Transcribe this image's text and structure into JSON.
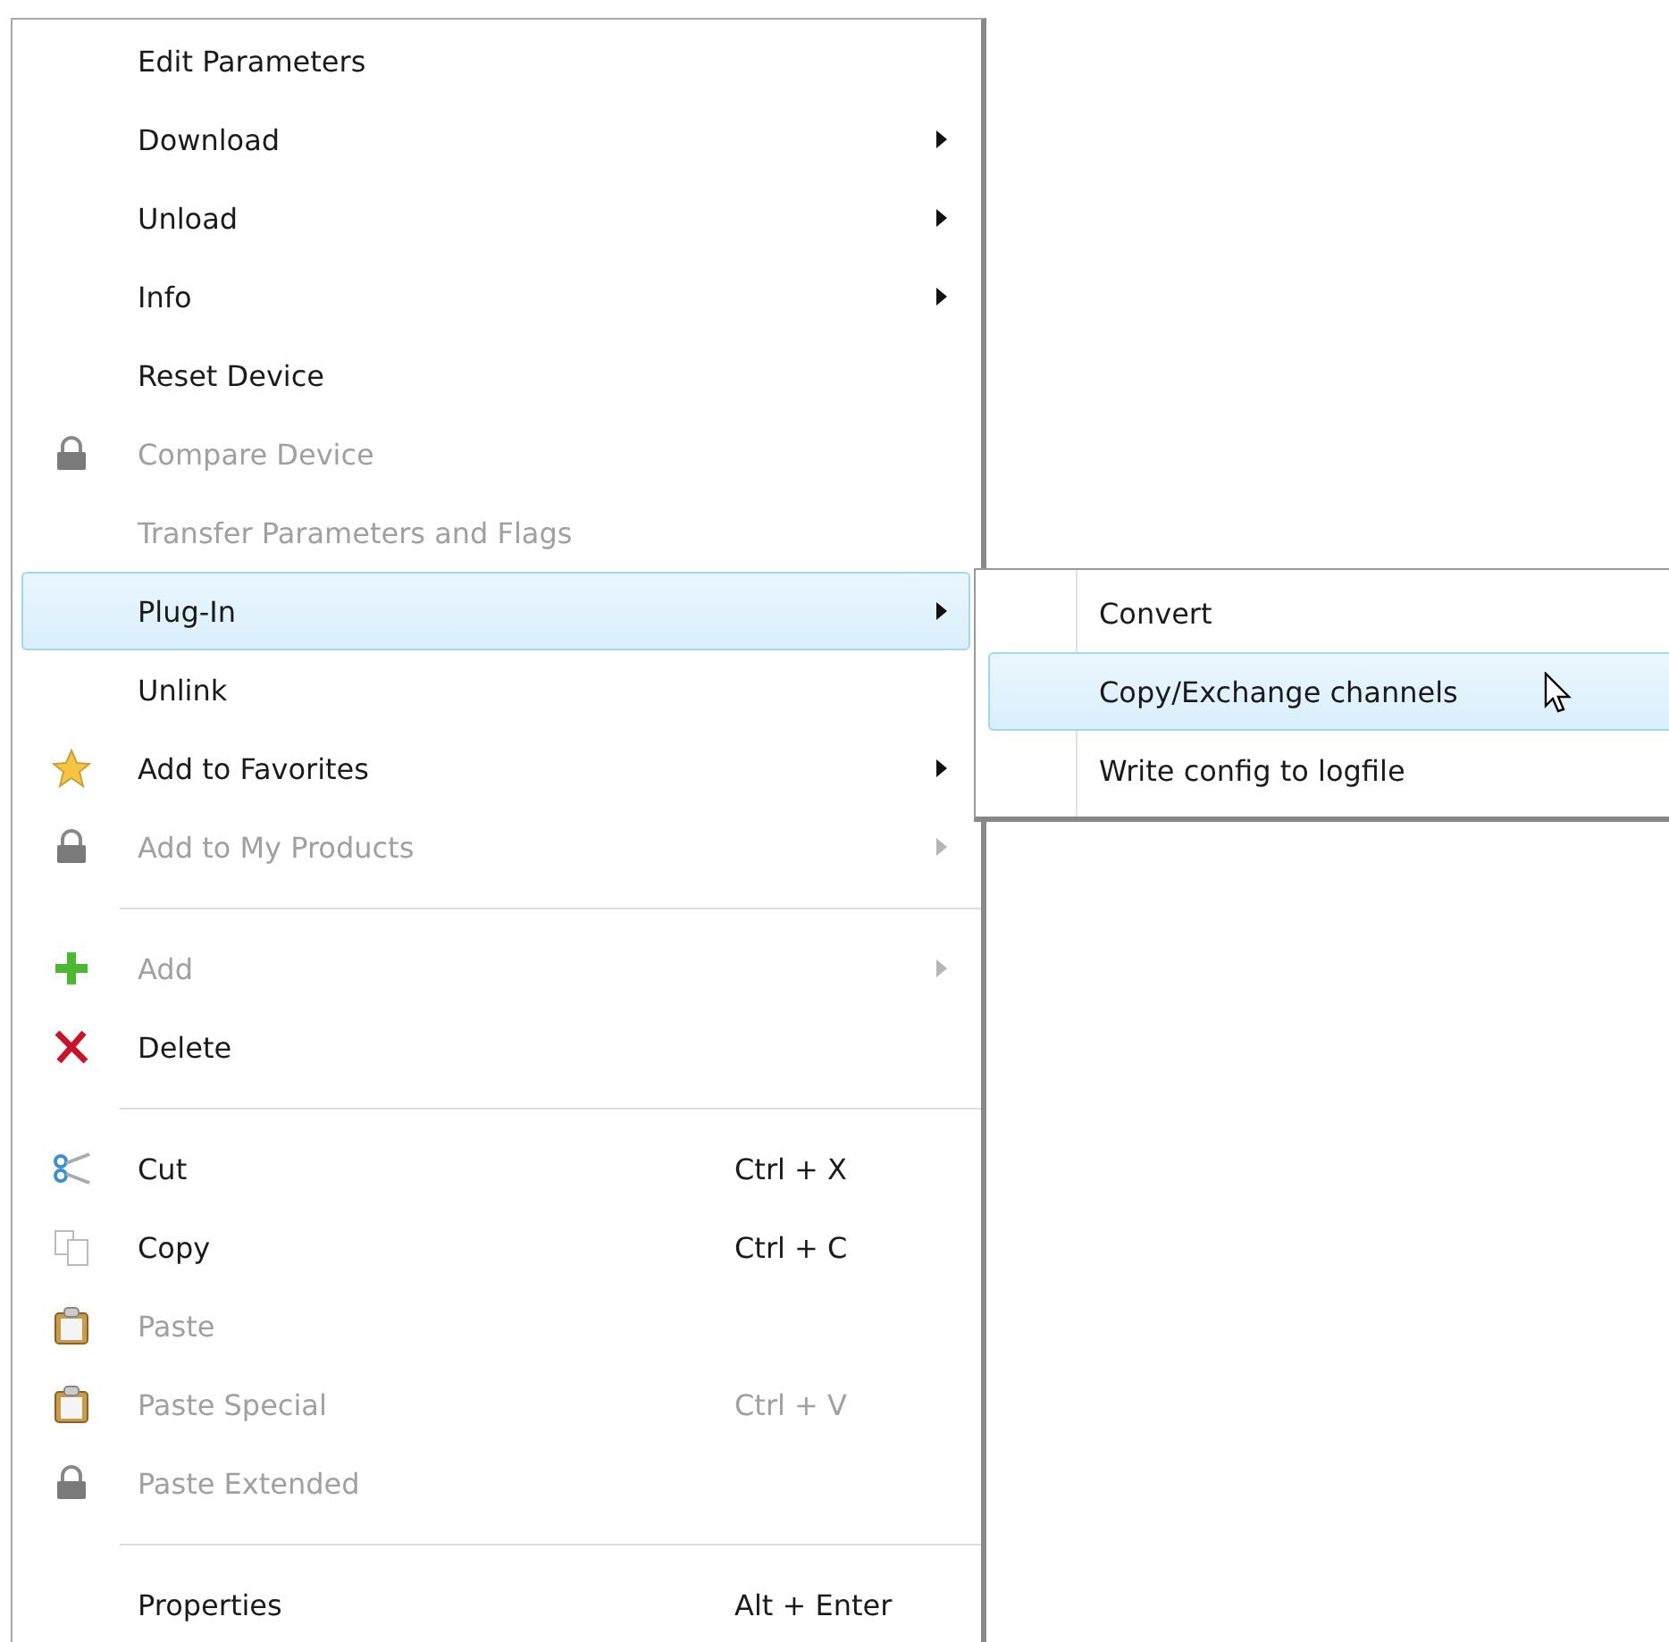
{
  "menu": {
    "items": [
      {
        "kind": "plain",
        "label": "Edit Parameters",
        "disabled": false,
        "submenu": false,
        "selected": false
      },
      {
        "kind": "plain",
        "label": "Download",
        "disabled": false,
        "submenu": true,
        "selected": false
      },
      {
        "kind": "plain",
        "label": "Unload",
        "disabled": false,
        "submenu": true,
        "selected": false
      },
      {
        "kind": "plain",
        "label": "Info",
        "disabled": false,
        "submenu": true,
        "selected": false
      },
      {
        "kind": "plain",
        "label": "Reset Device",
        "disabled": false,
        "submenu": false,
        "selected": false
      },
      {
        "kind": "lock",
        "label": "Compare Device",
        "disabled": true,
        "submenu": false,
        "selected": false
      },
      {
        "kind": "plain",
        "label": "Transfer Parameters and Flags",
        "disabled": true,
        "submenu": false,
        "selected": false
      },
      {
        "kind": "plain",
        "label": "Plug-In",
        "disabled": false,
        "submenu": true,
        "selected": true
      },
      {
        "kind": "plain",
        "label": "Unlink",
        "disabled": false,
        "submenu": false,
        "selected": false
      },
      {
        "kind": "star",
        "label": "Add to Favorites",
        "disabled": false,
        "submenu": true,
        "selected": false
      },
      {
        "kind": "lock",
        "label": "Add to My Products",
        "disabled": true,
        "submenu": true,
        "selected": false
      },
      {
        "kind": "separator"
      },
      {
        "kind": "plus",
        "label": "Add",
        "disabled": true,
        "submenu": true,
        "selected": false
      },
      {
        "kind": "cross",
        "label": "Delete",
        "disabled": false,
        "submenu": false,
        "selected": false
      },
      {
        "kind": "separator"
      },
      {
        "kind": "scissors",
        "label": "Cut",
        "shortcut": "Ctrl + X",
        "disabled": false,
        "submenu": false,
        "selected": false
      },
      {
        "kind": "copy",
        "label": "Copy",
        "shortcut": "Ctrl + C",
        "disabled": false,
        "submenu": false,
        "selected": false
      },
      {
        "kind": "clipboard",
        "label": "Paste",
        "disabled": true,
        "submenu": false,
        "selected": false
      },
      {
        "kind": "clipboard",
        "label": "Paste Special",
        "shortcut": "Ctrl + V",
        "disabled": true,
        "submenu": false,
        "selected": false
      },
      {
        "kind": "lock",
        "label": "Paste Extended",
        "disabled": true,
        "submenu": false,
        "selected": false
      },
      {
        "kind": "separator"
      },
      {
        "kind": "plain",
        "label": "Properties",
        "shortcut": "Alt + Enter",
        "disabled": false,
        "submenu": false,
        "selected": false
      }
    ]
  },
  "submenu": {
    "items": [
      {
        "label": "Convert",
        "selected": false
      },
      {
        "label": "Copy/Exchange channels",
        "selected": true
      },
      {
        "label": "Write config to logfile",
        "selected": false
      }
    ]
  }
}
